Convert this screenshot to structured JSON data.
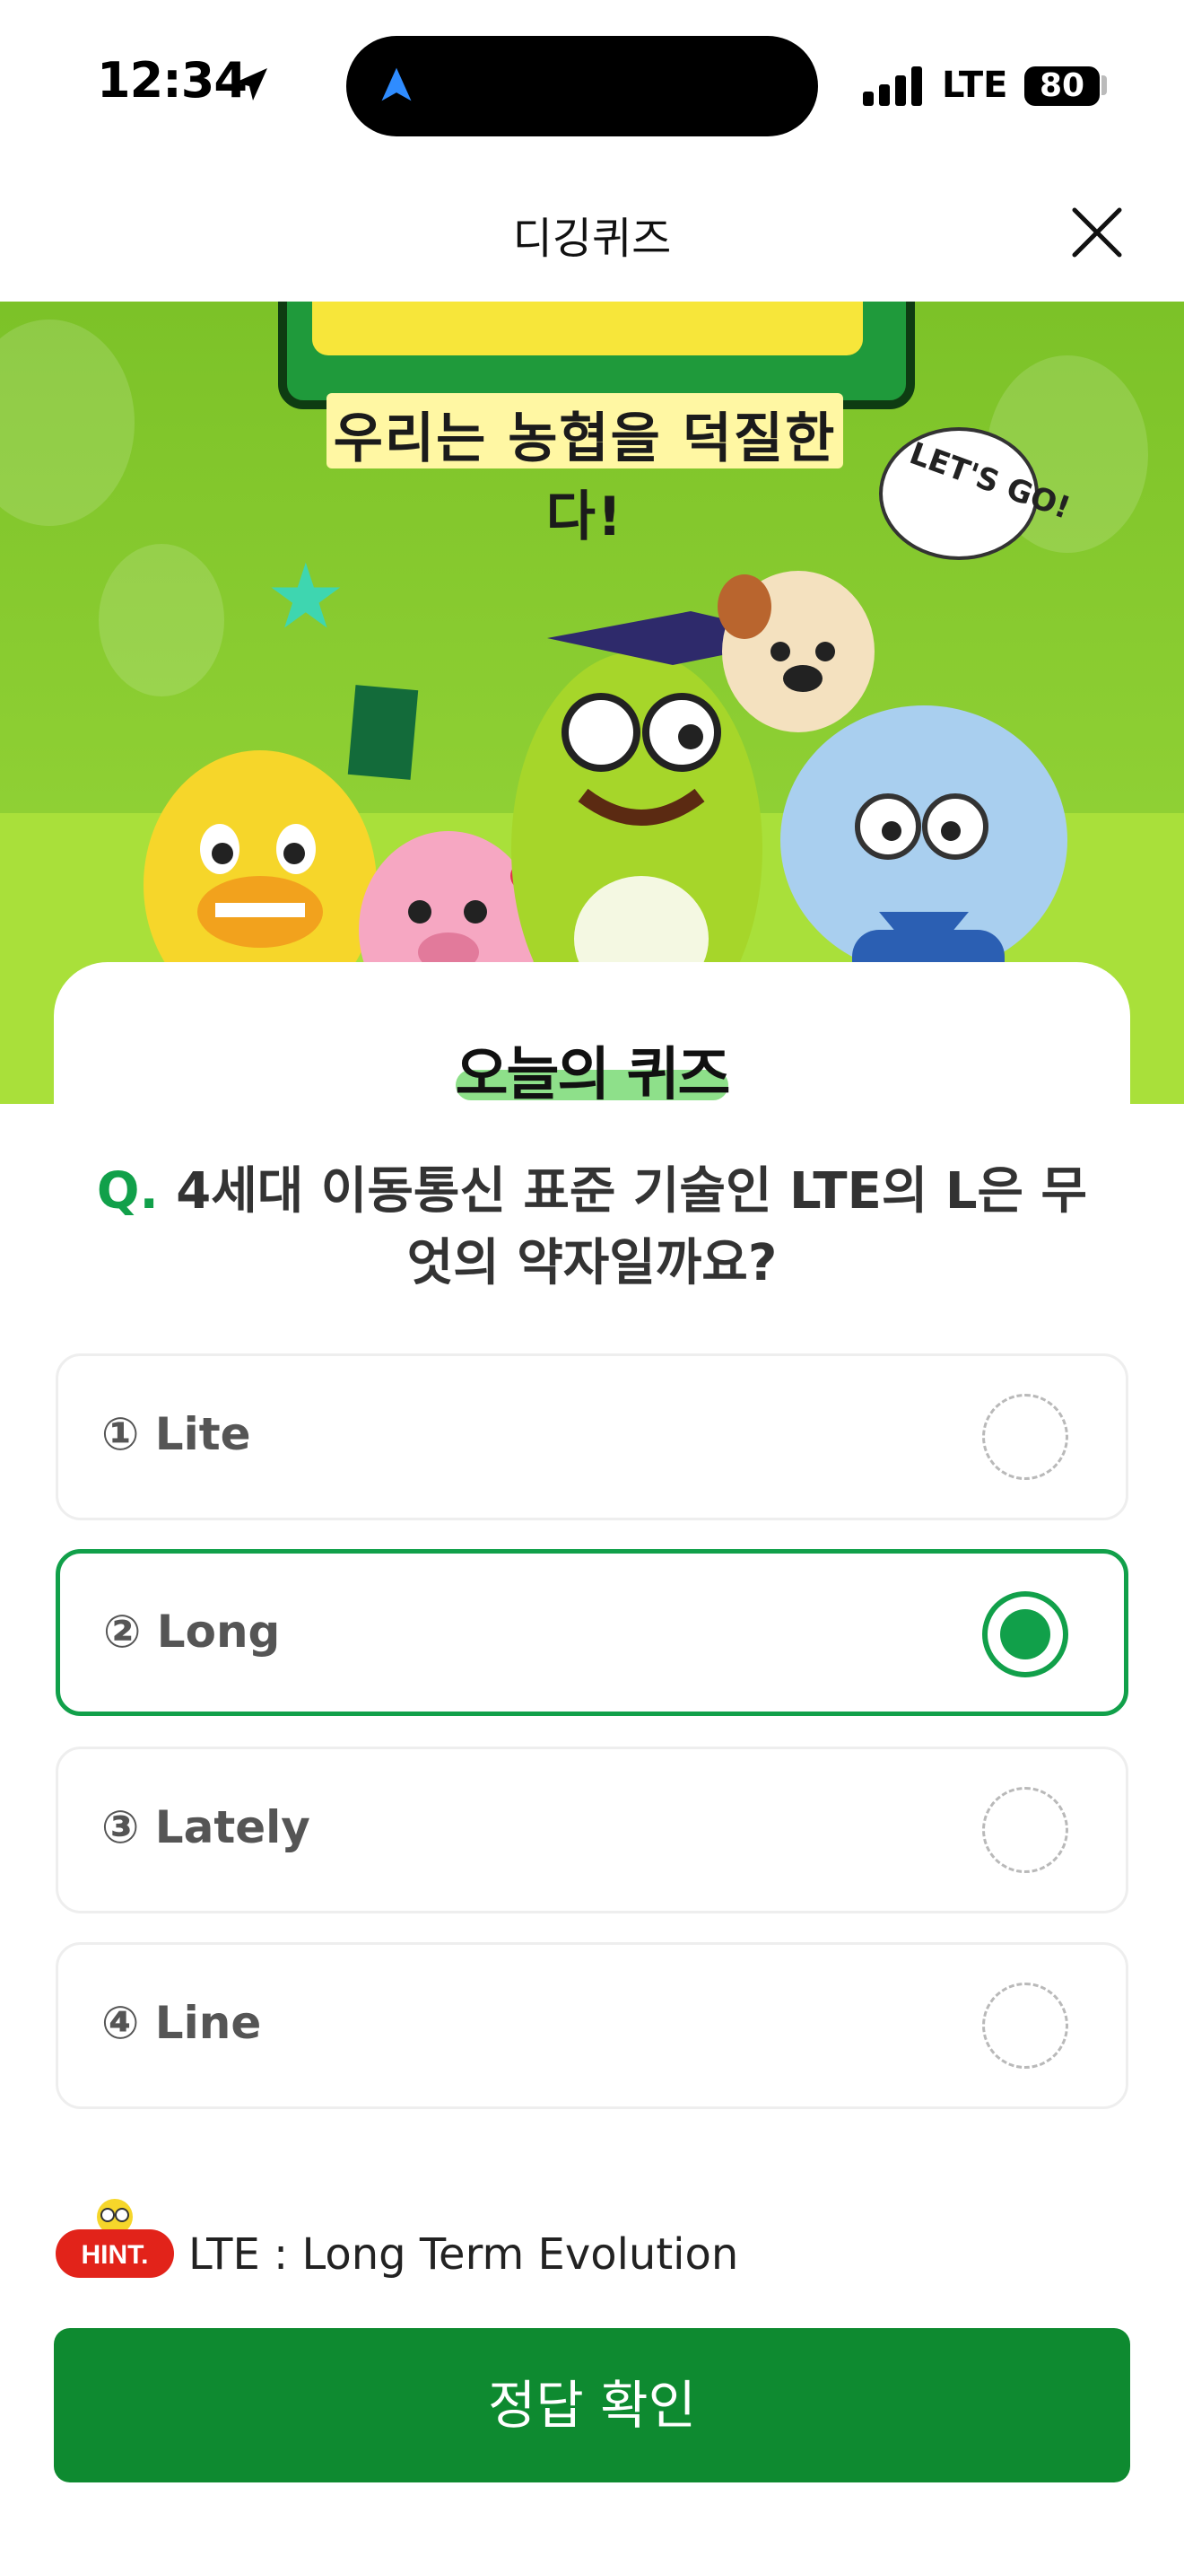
{
  "status_bar": {
    "time": "12:34",
    "network": "LTE",
    "battery": "80"
  },
  "header": {
    "title": "디깅퀴즈",
    "close_icon": "close-icon"
  },
  "banner": {
    "slogan": "우리는 농협을 덕질한다!",
    "speech_bubble": "LET'S GO!"
  },
  "quiz": {
    "heading": "오늘의 퀴즈",
    "question_prefix": "Q.",
    "question": "4세대 이동통신 표준 기술인 LTE의 L은 무엇의 약자일까요?",
    "options": [
      {
        "label": "① Lite",
        "selected": false
      },
      {
        "label": "② Long",
        "selected": true
      },
      {
        "label": "③ Lately",
        "selected": false
      },
      {
        "label": "④ Line",
        "selected": false
      }
    ],
    "hint_badge": "HINT.",
    "hint": "LTE : Long Term Evolution",
    "submit_label": "정답 확인"
  },
  "colors": {
    "accent": "#11a04a",
    "submit": "#0e8a30",
    "banner_green": "#8fcf2f",
    "hint_red": "#e2231a"
  }
}
